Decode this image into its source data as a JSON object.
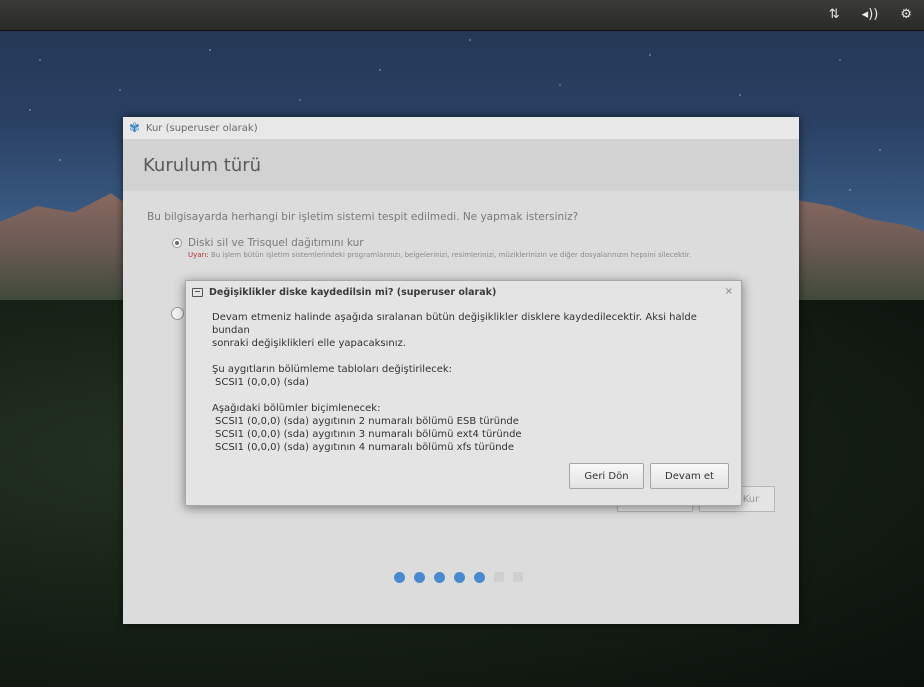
{
  "tray": {
    "network_icon": "network-updown-icon",
    "volume_icon": "volume-icon",
    "settings_icon": "gear-icon",
    "network_glyph": "⇅",
    "volume_glyph": "◂))",
    "settings_glyph": "⚙"
  },
  "installer": {
    "title": "Kur (superuser olarak)",
    "heading": "Kurulum türü",
    "question": "Bu bilgisayarda herhangi bir işletim sistemi tespit edilmedi. Ne yapmak istersiniz?",
    "option1_label": "Diski sil ve Trisquel dağıtımını kur",
    "warning_label": "Uyarı:",
    "warning_text": "Bu işlem bütün işletim sistemlerindeki programlarınızı, belgelerinizi, resimlerinizi, müziklerinizin ve diğer dosyalarınızın hepsini silecektir.",
    "install_button_partial": "Kur",
    "progress": {
      "total_steps": 7,
      "completed_steps": 5,
      "accent_color": "#4a8ad0"
    }
  },
  "dialog": {
    "title": "Değişiklikler diske kaydedilsin mi? (superuser olarak)",
    "close_glyph": "×",
    "intro_line1": "Devam etmeniz halinde aşağıda sıralanan bütün değişiklikler disklere kaydedilecektir. Aksi halde bundan",
    "intro_line2": "sonraki değişiklikleri elle yapacaksınız.",
    "partition_tables_heading": "Şu aygıtların bölümleme tabloları değiştirilecek:",
    "partition_tables": [
      "SCSI1 (0,0,0) (sda)"
    ],
    "formatted_heading": "Aşağıdaki bölümler biçimlenecek:",
    "formatted_partitions": [
      "SCSI1 (0,0,0) (sda) aygıtının 2 numaralı bölümü ESB türünde",
      "SCSI1 (0,0,0) (sda) aygıtının 3 numaralı bölümü ext4 türünde",
      "SCSI1 (0,0,0) (sda) aygıtının 4 numaralı bölümü xfs türünde"
    ],
    "back_button": "Geri Dön",
    "continue_button": "Devam et"
  }
}
